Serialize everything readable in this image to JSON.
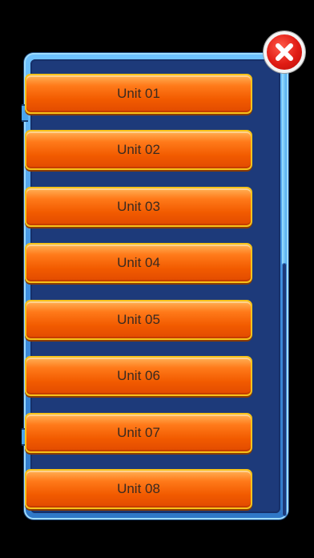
{
  "close": {
    "icon": "close-x-icon",
    "color": "#e01c14"
  },
  "units": [
    {
      "label": "Unit 01"
    },
    {
      "label": "Unit 02"
    },
    {
      "label": "Unit 03"
    },
    {
      "label": "Unit 04"
    },
    {
      "label": "Unit 05"
    },
    {
      "label": "Unit 06"
    },
    {
      "label": "Unit 07"
    },
    {
      "label": "Unit 08"
    }
  ],
  "colors": {
    "button_orange": "#f25b00",
    "button_border": "#f6c21a",
    "panel_blue": "#1d3a7a",
    "frame_blue": "#3e8fe0"
  }
}
